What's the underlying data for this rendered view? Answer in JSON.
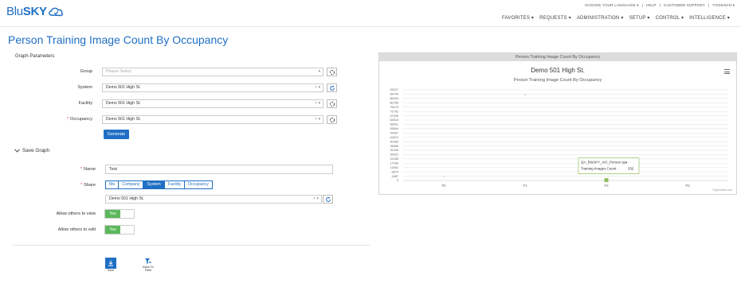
{
  "header": {
    "logo_text_a": "Blu",
    "logo_text_b": "SKY",
    "util_links": [
      "CHOOSE YOUR LANGUAGE ▾",
      "|",
      "HELP",
      "|",
      "CUSTOMER SUPPORT",
      "|",
      "YOGESHN ▾"
    ],
    "nav": [
      "FAVORITES ▾",
      "REQUESTS ▾",
      "ADMINISTRATION ▾",
      "SETUP ▾",
      "CONTROL ▾",
      "INTELLIGENCE ▾"
    ]
  },
  "page": {
    "title": "Person Training Image Count By Occupancy"
  },
  "params": {
    "section_label": "Graph Parameters",
    "group": {
      "label": "Group",
      "placeholder": "Please Select"
    },
    "system": {
      "label": "System",
      "value": "Demo 501 High St."
    },
    "facility": {
      "label": "Facility",
      "value": "Demo 501 High St."
    },
    "occupancy": {
      "label": "Occupancy",
      "value": "Demo 501 High St.",
      "required_mark": "*"
    },
    "generate_label": "Generate"
  },
  "save_graph": {
    "label": "Save Graph",
    "name_label": "Name",
    "name_value": "Test",
    "share_label": "Share",
    "share_options": [
      "Me",
      "Company",
      "System",
      "Facility",
      "Occupancy"
    ],
    "share_selected": "System",
    "share_select_value": "Demo 501 High St.",
    "allow_view_label": "Allow others to view",
    "allow_view_value": "Yes",
    "allow_edit_label": "Allow others to edit",
    "allow_edit_value": "Yes",
    "required_mark": "*"
  },
  "actions": {
    "save_label": "Save",
    "back_label_1": "Back To",
    "back_label_2": "Filter"
  },
  "chart_panel": {
    "header": "Person Training Image Count By Occupancy",
    "credits": "Highcharts.com"
  },
  "chart_data": {
    "type": "scatter",
    "title": "Demo 501 High St.",
    "subtitle": "Person Training Image Count By Occupancy",
    "x_categories": [
      "P0",
      "P1",
      "P2",
      "P3"
    ],
    "y_ticks": [
      "0",
      "4487",
      "8974",
      "13461",
      "17948",
      "22435",
      "26922",
      "31409",
      "35896",
      "40383",
      "44870",
      "49357",
      "53844",
      "58331",
      "62818",
      "67305",
      "71792",
      "76279",
      "80766",
      "85253",
      "89740",
      "94227"
    ],
    "ylim": [
      0,
      94227
    ],
    "points": [
      {
        "x": 0,
        "y": 4100,
        "color": "#cccccc"
      },
      {
        "x": 1,
        "y": 89000,
        "color": "#cccccc"
      },
      {
        "x": 2,
        "y": 332,
        "color": "#90c060"
      }
    ],
    "tooltip": {
      "title": "QA_BluSKY_AIC_Person spa",
      "label": "Training Images Count :",
      "value": "332"
    }
  }
}
